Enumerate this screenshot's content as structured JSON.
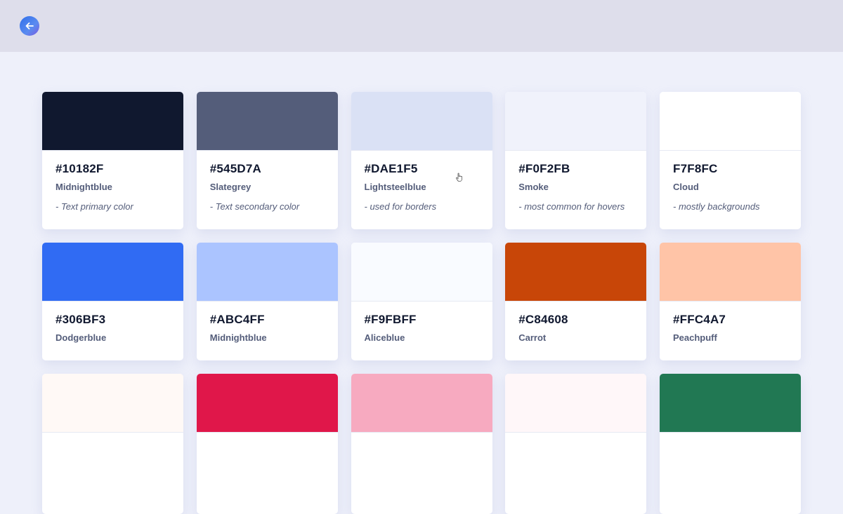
{
  "header": {
    "back_icon": "arrow-left-icon"
  },
  "cards": [
    {
      "hex": "#10182F",
      "name": "Midnightblue",
      "desc": "- Text primary color",
      "color": "#10182F"
    },
    {
      "hex": "#545D7A",
      "name": "Slategrey",
      "desc": "- Text secondary color",
      "color": "#545D7A"
    },
    {
      "hex": "#DAE1F5",
      "name": "Lightsteelblue",
      "desc": "- used for borders",
      "color": "#DAE1F5"
    },
    {
      "hex": "#F0F2FB",
      "name": "Smoke",
      "desc": "- most common for hovers",
      "color": "#F0F2FB"
    },
    {
      "hex": "F7F8FC",
      "name": "Cloud",
      "desc": "- mostly backgrounds",
      "color": "#FFFFFF"
    },
    {
      "hex": "#306BF3",
      "name": "Dodgerblue",
      "desc": "",
      "color": "#306BF3"
    },
    {
      "hex": "#ABC4FF",
      "name": "Midnightblue",
      "desc": "",
      "color": "#ABC4FF"
    },
    {
      "hex": "#F9FBFF",
      "name": "Aliceblue",
      "desc": "",
      "color": "#F9FBFF"
    },
    {
      "hex": "#C84608",
      "name": "Carrot",
      "desc": "",
      "color": "#C84608"
    },
    {
      "hex": "#FFC4A7",
      "name": "Peachpuff",
      "desc": "",
      "color": "#FFC4A7"
    },
    {
      "hex": "",
      "name": "",
      "desc": "",
      "color": "#FFF9F6"
    },
    {
      "hex": "",
      "name": "",
      "desc": "",
      "color": "#E0174A"
    },
    {
      "hex": "",
      "name": "",
      "desc": "",
      "color": "#F7AAC0"
    },
    {
      "hex": "",
      "name": "",
      "desc": "",
      "color": "#FFF7F9"
    },
    {
      "hex": "",
      "name": "",
      "desc": "",
      "color": "#217853"
    }
  ]
}
